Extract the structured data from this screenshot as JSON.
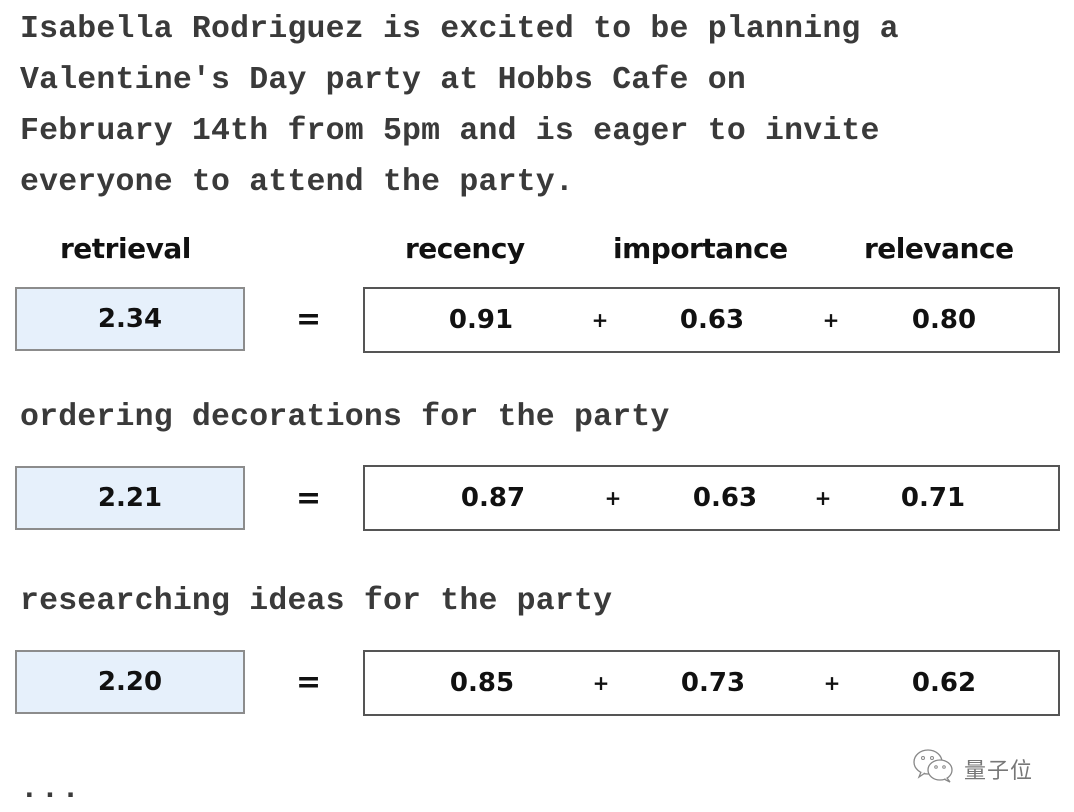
{
  "summary": "Isabella Rodriguez is excited to be planning a\nValentine's Day party at Hobbs Cafe on\nFebruary 14th from 5pm and is eager to invite\neveryone to attend the party.",
  "headers": {
    "retrieval": "retrieval",
    "recency": "recency",
    "importance": "importance",
    "relevance": "relevance"
  },
  "operators": {
    "equals": "=",
    "plus": "+"
  },
  "colors": {
    "retrieval_box_fill": "#e6f0fb",
    "text": "#111111",
    "mono_text": "#3a3a3a"
  },
  "memories": [
    {
      "query": "",
      "retrieval": "2.34",
      "recency": "0.91",
      "importance": "0.63",
      "relevance": "0.80"
    },
    {
      "query": "ordering decorations for the party",
      "retrieval": "2.21",
      "recency": "0.87",
      "importance": "0.63",
      "relevance": "0.71"
    },
    {
      "query": "researching ideas for the party",
      "retrieval": "2.20",
      "recency": "0.85",
      "importance": "0.73",
      "relevance": "0.62"
    }
  ],
  "ellipsis": "...",
  "watermark": {
    "icon": "wechat-icon",
    "text": "量子位"
  }
}
